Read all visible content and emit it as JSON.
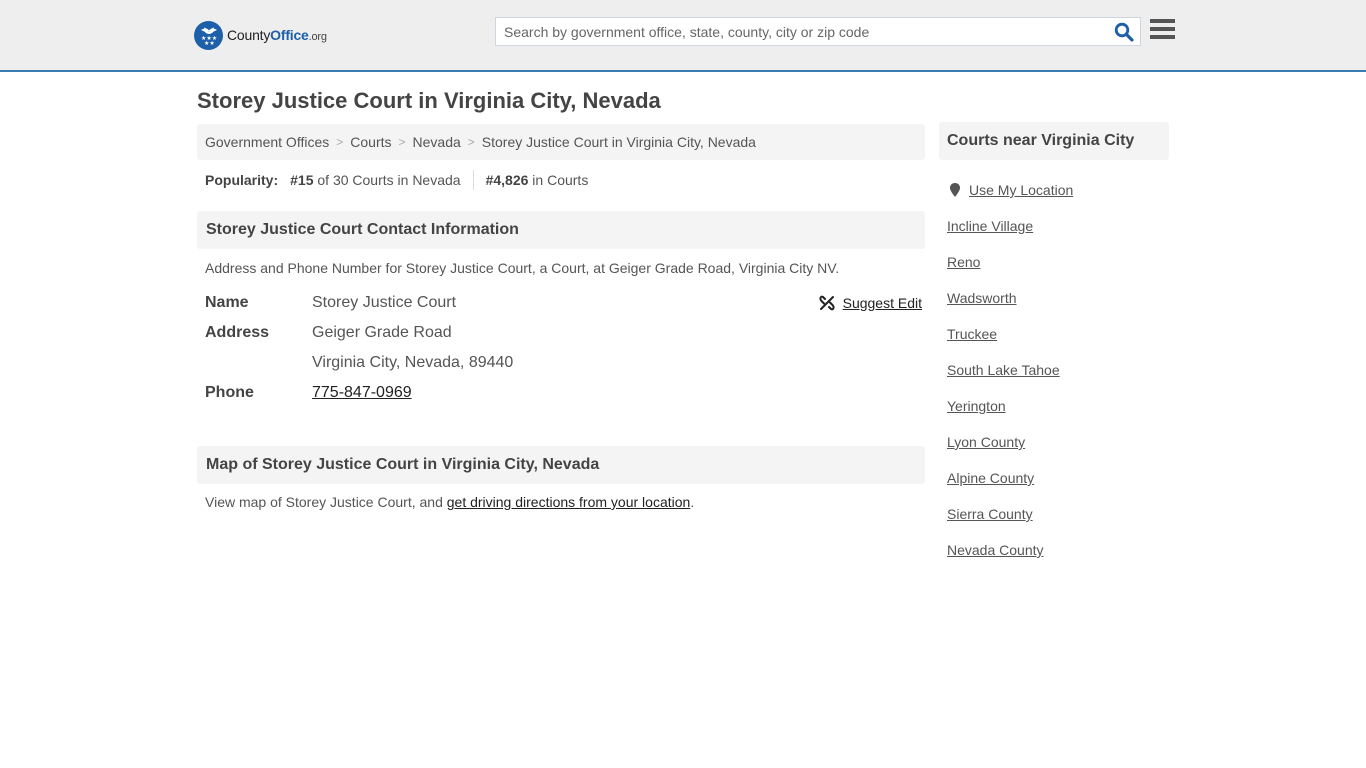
{
  "header": {
    "logo": {
      "part1": "County",
      "part2": "Office",
      "part3": ".org",
      "icon": "eagle-stars-badge-icon"
    },
    "search": {
      "placeholder": "Search by government office, state, county, city or zip code",
      "value": "",
      "icon": "search-icon"
    },
    "menu_icon": "hamburger-menu-icon",
    "accent_color": "#3a7cb0",
    "brand_color": "#1d5fa8"
  },
  "page_title": "Storey Justice Court in Virginia City, Nevada",
  "breadcrumb": [
    {
      "label": "Government Offices"
    },
    {
      "label": "Courts"
    },
    {
      "label": "Nevada"
    },
    {
      "label": "Storey Justice Court in Virginia City, Nevada"
    }
  ],
  "popularity": {
    "label": "Popularity:",
    "state_rank": "#15",
    "state_rank_suffix": "of 30 Courts in Nevada",
    "national_rank": "#4,826",
    "national_rank_suffix": "in Courts"
  },
  "contact": {
    "heading": "Storey Justice Court Contact Information",
    "description": "Address and Phone Number for Storey Justice Court, a Court, at Geiger Grade Road, Virginia City NV.",
    "suggest_edit": "Suggest Edit",
    "suggest_icon": "broken-link-icon",
    "rows": {
      "name_label": "Name",
      "name_value": "Storey Justice Court",
      "address_label": "Address",
      "address_line1": "Geiger Grade Road",
      "address_line2": "Virginia City, Nevada, 89440",
      "phone_label": "Phone",
      "phone_value": "775-847-0969"
    }
  },
  "map": {
    "heading": "Map of Storey Justice Court in Virginia City, Nevada",
    "desc_prefix": "View map of Storey Justice Court, and ",
    "desc_link": "get driving directions from your location",
    "desc_suffix": "."
  },
  "sidebar": {
    "heading": "Courts near Virginia City",
    "use_location": "Use My Location",
    "location_icon": "map-pin-icon",
    "links": [
      "Incline Village",
      "Reno",
      "Wadsworth",
      "Truckee",
      "South Lake Tahoe",
      "Yerington",
      "Lyon County",
      "Alpine County",
      "Sierra County",
      "Nevada County"
    ]
  }
}
